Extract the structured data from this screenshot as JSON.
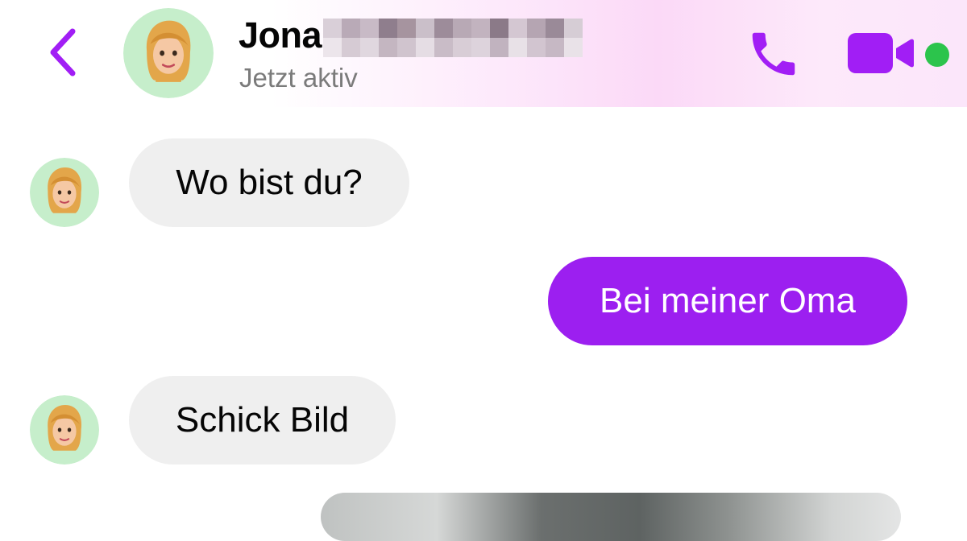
{
  "header": {
    "contact_name": "Jona",
    "status": "Jetzt aktiv",
    "name_redacted": true,
    "online": true,
    "icons": [
      "chevron-left-icon",
      "avatar",
      "phone-icon",
      "video-camera-icon",
      "online-dot"
    ]
  },
  "messages": [
    {
      "direction": "incoming",
      "text": "Wo bist du?"
    },
    {
      "direction": "outgoing",
      "text": "Bei meiner Oma"
    },
    {
      "direction": "incoming",
      "text": "Schick Bild"
    },
    {
      "direction": "outgoing",
      "type": "photo"
    }
  ],
  "colors": {
    "accent": "#9c1ff0",
    "icon_purple": "#a11ef5",
    "incoming_bubble": "#efefef",
    "avatar_bg": "#c6eecb",
    "online": "#2cc44c",
    "status_text": "#7b7b7b"
  }
}
